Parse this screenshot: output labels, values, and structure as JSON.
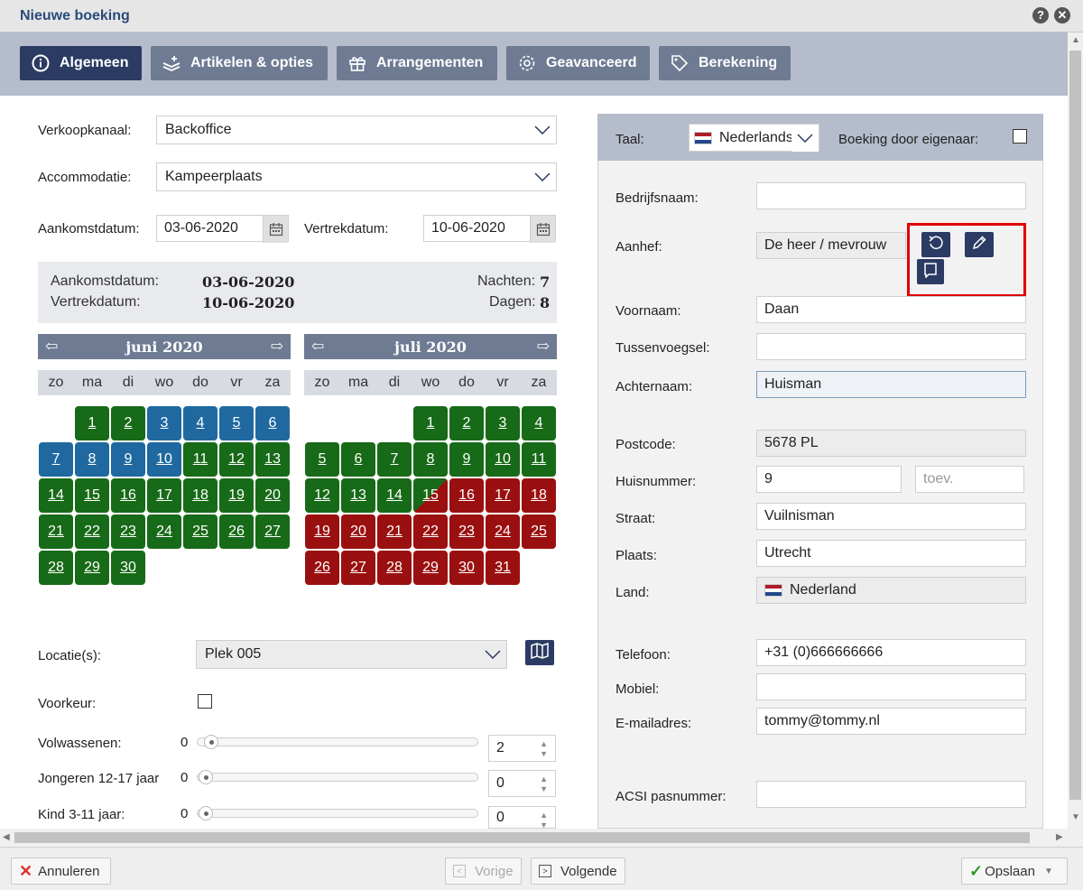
{
  "window": {
    "title": "Nieuwe boeking"
  },
  "tabs": [
    {
      "label": "Algemeen",
      "icon": "info-icon"
    },
    {
      "label": "Artikelen & opties",
      "icon": "articles-icon"
    },
    {
      "label": "Arrangementen",
      "icon": "gift-icon"
    },
    {
      "label": "Geavanceerd",
      "icon": "gear-icon"
    },
    {
      "label": "Berekening",
      "icon": "tag-icon"
    }
  ],
  "form": {
    "verkoopkanaal_label": "Verkoopkanaal:",
    "verkoopkanaal_value": "Backoffice",
    "accommodatie_label": "Accommodatie:",
    "accommodatie_value": "Kampeerplaats",
    "aankomst_label": "Aankomstdatum:",
    "aankomst_value": "03-06-2020",
    "vertrek_label": "Vertrekdatum:",
    "vertrek_value": "10-06-2020"
  },
  "summary": {
    "aankomst_label": "Aankomstdatum:",
    "aankomst_value": "03-06-2020",
    "vertrek_label": "Vertrekdatum:",
    "vertrek_value": "10-06-2020",
    "nachten_label": "Nachten:",
    "nachten_value": "7",
    "dagen_label": "Dagen:",
    "dagen_value": "8"
  },
  "calendar": {
    "months": [
      "juni 2020",
      "juli 2020"
    ],
    "weekdays": [
      "zo",
      "ma",
      "di",
      "wo",
      "do",
      "vr",
      "za"
    ],
    "june": {
      "offset": 1,
      "days": [
        "g",
        "g",
        "b",
        "b",
        "b",
        "b",
        "b",
        "b",
        "b",
        "b",
        "g",
        "g",
        "g",
        "g",
        "g",
        "g",
        "g",
        "g",
        "g",
        "g",
        "g",
        "g",
        "g",
        "g",
        "g",
        "g",
        "g",
        "g",
        "g",
        "g"
      ]
    },
    "july": {
      "offset": 3,
      "days": [
        "g",
        "g",
        "g",
        "g",
        "g",
        "g",
        "g",
        "g",
        "g",
        "g",
        "g",
        "g",
        "g",
        "g",
        "s",
        "r",
        "r",
        "r",
        "r",
        "r",
        "r",
        "r",
        "r",
        "r",
        "r",
        "r",
        "r",
        "r",
        "r",
        "r",
        "r"
      ]
    },
    "colors": {
      "g": "#176a17",
      "b": "#1f69a0",
      "r": "#9a1010"
    }
  },
  "lower": {
    "locatie_label": "Locatie(s):",
    "locatie_value": "Plek 005",
    "voorkeur_label": "Voorkeur:",
    "volwassenen_label": "Volwassenen:",
    "volwassenen_min": "0",
    "volwassenen_value": "2",
    "jongeren_label": "Jongeren 12-17 jaar",
    "jongeren_min": "0",
    "jongeren_value": "0",
    "kind_label": "Kind 3-11 jaar:",
    "kind_min": "0",
    "kind_value": "0"
  },
  "right": {
    "taal_label": "Taal:",
    "taal_value": "Nederlands",
    "eigenaar_label": "Boeking door eigenaar:",
    "bedrijfsnaam_label": "Bedrijfsnaam:",
    "aanhef_label": "Aanhef:",
    "aanhef_value": "De heer / mevrouw",
    "voornaam_label": "Voornaam:",
    "voornaam_value": "Daan",
    "tussenvoegsel_label": "Tussenvoegsel:",
    "achternaam_label": "Achternaam:",
    "achternaam_value": "Huisman",
    "postcode_label": "Postcode:",
    "postcode_value": "5678 PL",
    "huisnummer_label": "Huisnummer:",
    "huisnummer_value": "9",
    "toev_placeholder": "toev.",
    "straat_label": "Straat:",
    "straat_value": "Vuilnisman",
    "plaats_label": "Plaats:",
    "plaats_value": "Utrecht",
    "land_label": "Land:",
    "land_value": "Nederland",
    "telefoon_label": "Telefoon:",
    "telefoon_value": "+31 (0)666666666",
    "mobiel_label": "Mobiel:",
    "email_label": "E-mailadres:",
    "email_value": "tommy@tommy.nl",
    "acsi_label": "ACSI pasnummer:"
  },
  "footer": {
    "cancel": "Annuleren",
    "prev": "Vorige",
    "next": "Volgende",
    "save": "Opslaan"
  }
}
